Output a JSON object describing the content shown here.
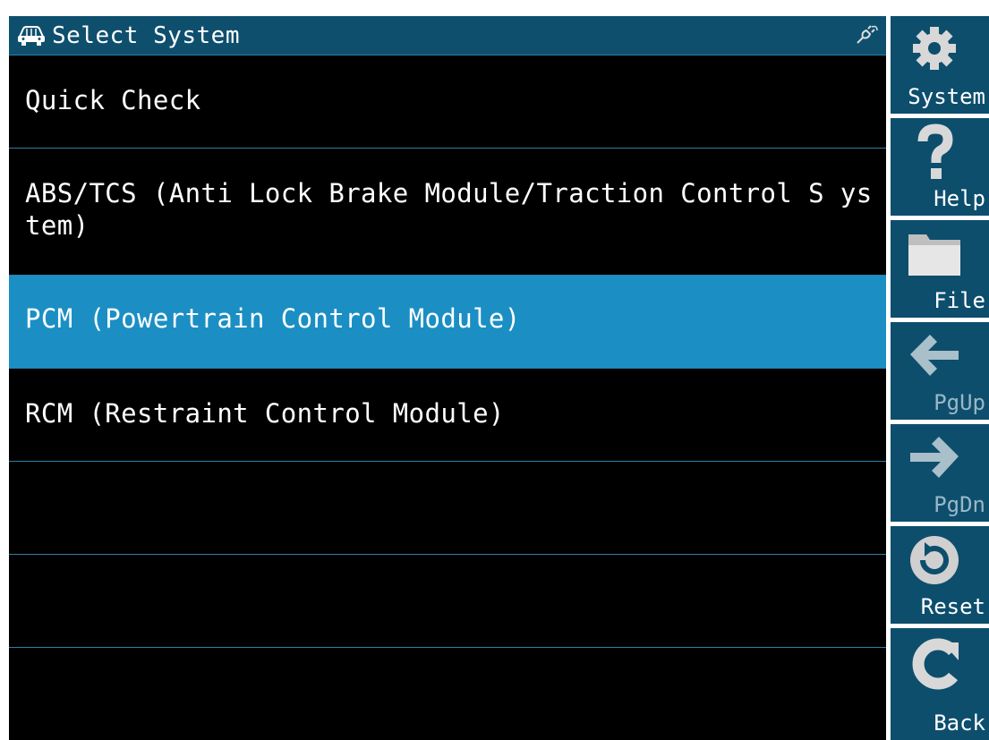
{
  "title_bar": {
    "title": "Select System",
    "car_icon": "car-icon",
    "status_icon": "connector-plug-icon"
  },
  "menu": {
    "items": [
      {
        "label": "Quick Check",
        "selected": false
      },
      {
        "label": "ABS/TCS (Anti Lock Brake Module/Traction Control S ystem)",
        "selected": false
      },
      {
        "label": "PCM (Powertrain Control Module)",
        "selected": true
      },
      {
        "label": "RCM (Restraint Control Module)",
        "selected": false
      },
      {
        "label": "",
        "selected": false
      },
      {
        "label": "",
        "selected": false
      },
      {
        "label": "",
        "selected": false
      }
    ]
  },
  "sidebar": {
    "buttons": [
      {
        "label": "System",
        "icon": "gear-icon",
        "enabled": true
      },
      {
        "label": "Help",
        "icon": "question-mark-icon",
        "enabled": true
      },
      {
        "label": "File",
        "icon": "folder-icon",
        "enabled": true
      },
      {
        "label": "PgUp",
        "icon": "arrow-left-icon",
        "enabled": false
      },
      {
        "label": "PgDn",
        "icon": "arrow-right-icon",
        "enabled": false
      },
      {
        "label": "Reset",
        "icon": "reset-icon",
        "enabled": true
      },
      {
        "label": "Back",
        "icon": "back-icon",
        "enabled": true
      }
    ]
  },
  "colors": {
    "title_bar": "#0f4f6e",
    "selected_row": "#1b8fc4",
    "row_divider": "#2d7fa8",
    "sidebar_button": "#0d4e6d",
    "list_background": "#000000"
  }
}
